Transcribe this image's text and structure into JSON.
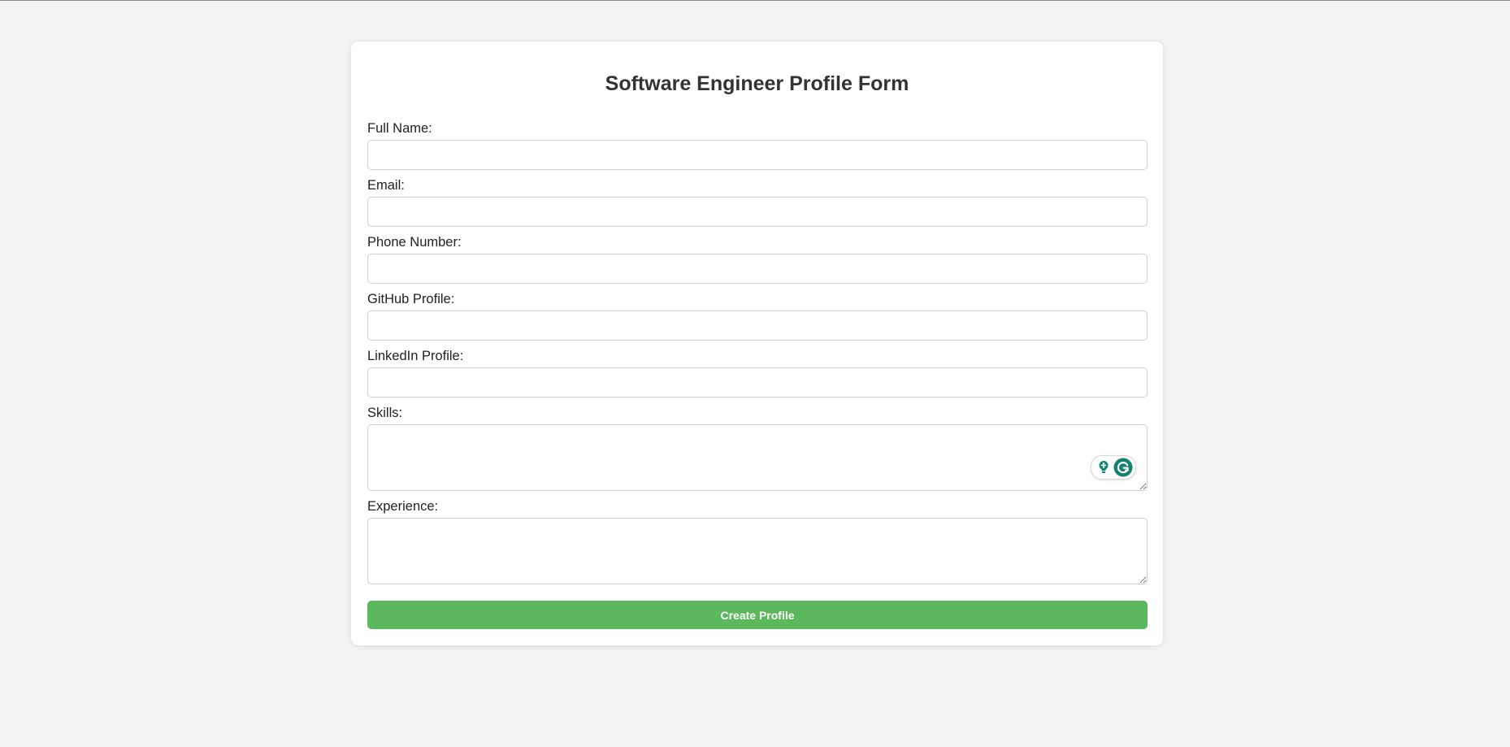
{
  "form": {
    "title": "Software Engineer Profile Form",
    "fields": {
      "full_name": {
        "label": "Full Name:",
        "value": "",
        "placeholder": ""
      },
      "email": {
        "label": "Email:",
        "value": "",
        "placeholder": ""
      },
      "phone": {
        "label": "Phone Number:",
        "value": "",
        "placeholder": ""
      },
      "github": {
        "label": "GitHub Profile:",
        "value": "",
        "placeholder": ""
      },
      "linkedin": {
        "label": "LinkedIn Profile:",
        "value": "",
        "placeholder": ""
      },
      "skills": {
        "label": "Skills:",
        "value": "",
        "placeholder": ""
      },
      "experience": {
        "label": "Experience:",
        "value": "",
        "placeholder": ""
      }
    },
    "submit_label": "Create Profile"
  },
  "widgets": {
    "grammarly_icons": [
      "lightbulb-icon",
      "grammarly-g-icon"
    ]
  },
  "colors": {
    "page_background": "#f3f3f3",
    "card_background": "#ffffff",
    "title_text": "#333333",
    "submit_button": "#5cb85c",
    "submit_text": "#ffffff",
    "input_border": "#cfcfcf",
    "grammarly_teal": "#15826f"
  }
}
